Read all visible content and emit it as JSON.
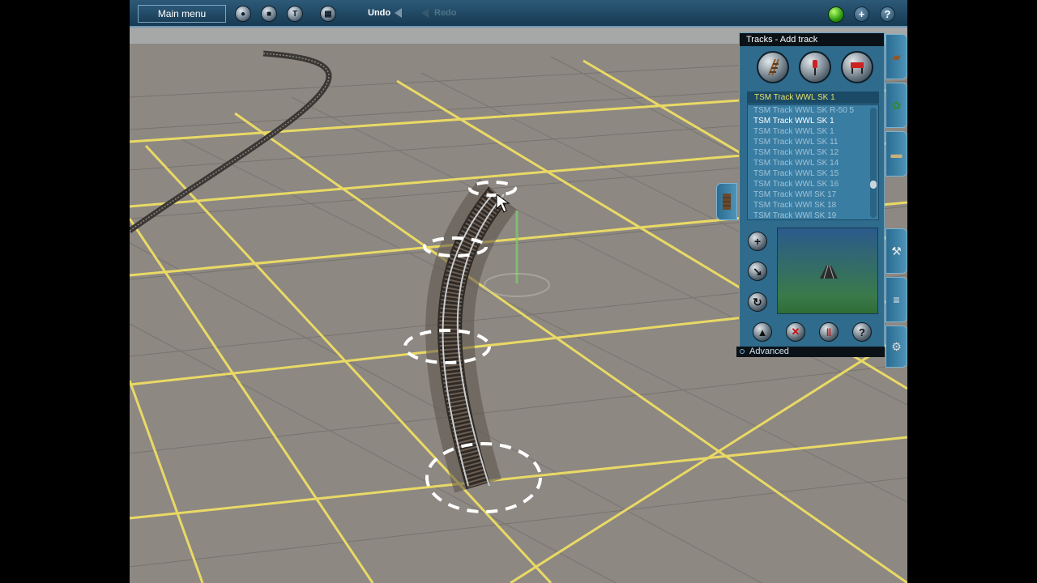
{
  "toolbar": {
    "main_menu_label": "Main menu",
    "undo_label": "Undo",
    "redo_label": "Redo",
    "icons": [
      "globe-icon",
      "stop-icon",
      "tools-icon",
      "grid-icon",
      "undo-arrow-icon",
      "redo-arrow-icon",
      "status-light-icon",
      "add-icon",
      "help-icon"
    ]
  },
  "panel": {
    "title": "Tracks - Add track",
    "selected_track": "TSM Track WWL SK 1",
    "tracks": [
      {
        "label": "TSM Track WWL SK R-50 5",
        "active": false
      },
      {
        "label": "TSM Track WWL SK 1",
        "active": true
      },
      {
        "label": "TSM Track WWL SK 1",
        "active": false
      },
      {
        "label": "TSM Track WWL SK 11",
        "active": false
      },
      {
        "label": "TSM Track WWL SK 12",
        "active": false
      },
      {
        "label": "TSM Track WWL SK 14",
        "active": false
      },
      {
        "label": "TSM Track WWL SK 15",
        "active": false
      },
      {
        "label": "TSM Track WWL SK 16",
        "active": false
      },
      {
        "label": "TSM Track WWl SK 17",
        "active": false
      },
      {
        "label": "TSM Track WWl SK 18",
        "active": false
      },
      {
        "label": "TSM Track WWl SK 19",
        "active": false
      }
    ],
    "advanced_label": "Advanced"
  },
  "colors": {
    "panel_bg": "#2f6b8c",
    "grid_line": "#f2e46a",
    "ground": "#8f8b85",
    "status_light": "#3bd114"
  }
}
